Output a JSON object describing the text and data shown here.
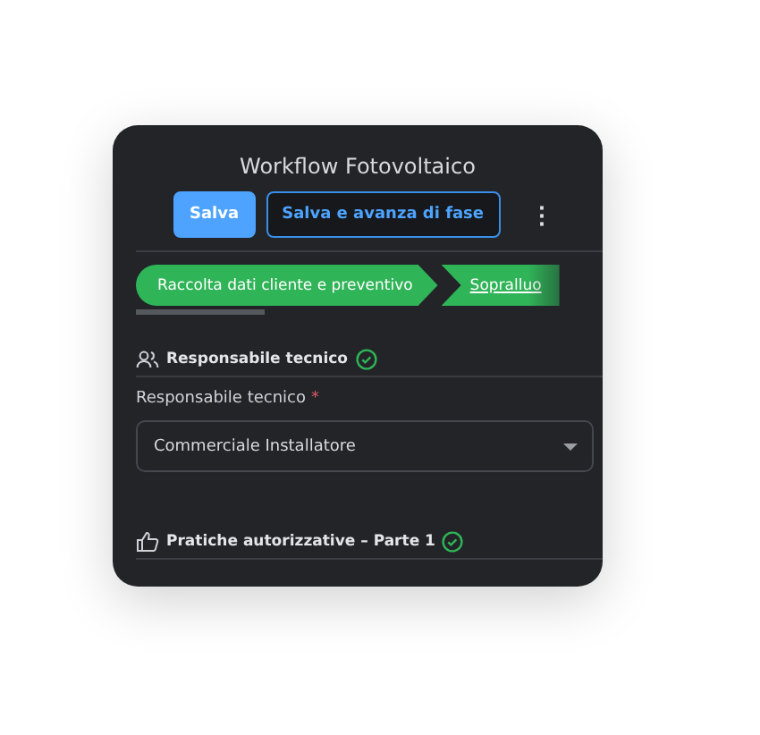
{
  "title": "Workflow Fotovoltaico",
  "buttons": [
    {
      "label": "Salva",
      "kind": "primary"
    },
    {
      "label": "Salva e avanza di fase",
      "kind": "outline"
    }
  ],
  "more_menu": "⋮",
  "steps": [
    {
      "label": "Raccolta dati cliente e preventivo",
      "selected": true
    },
    {
      "label": "Sopralluo",
      "selected": false
    }
  ],
  "sections": [
    {
      "title": "Responsabile tecnico",
      "complete": true,
      "fields": [
        {
          "label": "Responsabile tecnico",
          "required_mark": "*",
          "value": "Commerciale Installatore"
        }
      ]
    },
    {
      "title": "Pratiche autorizzative – Parte 1",
      "complete": true
    }
  ]
}
